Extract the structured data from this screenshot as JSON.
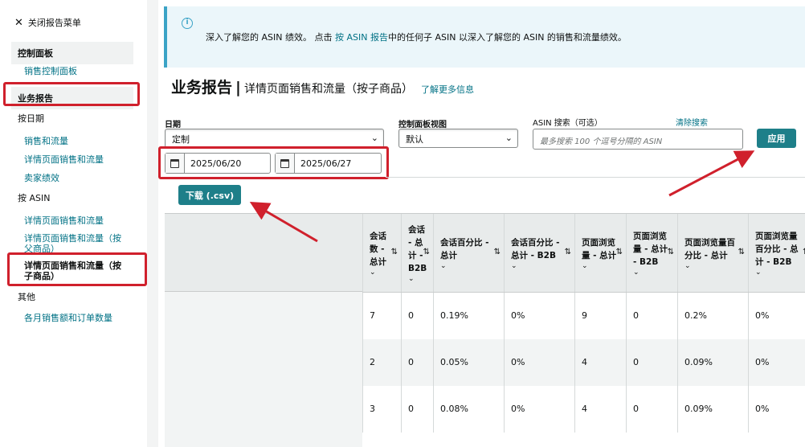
{
  "sidebar": {
    "close_label": "关闭报告菜单",
    "dashboard_header": "控制面板",
    "sales_dashboard": "销售控制面板",
    "business_reports_header": "业务报告",
    "by_date": "按日期",
    "by_date_items": [
      "销售和流量",
      "详情页面销售和流量",
      "卖家绩效"
    ],
    "by_asin": "按 ASIN",
    "asin_item_1": "详情页面销售和流量",
    "asin_item_2_line1": "详情页面销售和流量（按",
    "asin_item_2_line2": "父商品）",
    "asin_item_3_line1": "详情页面销售和流量（按",
    "asin_item_3_line2": "子商品）",
    "other": "其他",
    "monthly": "各月销售额和订单数量"
  },
  "banner": {
    "icon": "i",
    "text_before": "深入了解您的 ASIN 绩效。 点击",
    "link": "按 ASIN 报告",
    "text_after": "中的任何子 ASIN 以深入了解您的 ASIN 的销售和流量绩效。"
  },
  "title": {
    "main": "业务报告",
    "sep": "|",
    "sub": "详情页面销售和流量（按子商品）",
    "learn_more": "了解更多信息"
  },
  "filters": {
    "date_label": "日期",
    "date_value": "定制",
    "start_date": "2025/06/20",
    "end_date": "2025/06/27",
    "view_label": "控制面板视图",
    "view_value": "默认",
    "asin_label": "ASIN 搜索（可选）",
    "clear_search": "清除搜索",
    "asin_placeholder": "最多搜索 100 个逗号分隔的 ASIN",
    "apply": "应用",
    "download": "下载 (.csv)"
  },
  "table": {
    "headers": [
      "会话数 - 总计",
      "会话 - 总计 - B2B",
      "会话百分比 - 总计",
      "会话百分比 - 总计 - B2B",
      "页面浏览量 - 总计",
      "页面浏览量 - 总计 - B2B",
      "页面浏览量百分比 - 总计",
      "页面浏览量百分比 - 总计 - B2B"
    ],
    "header_display": [
      "会<br>话<br>数 -<br>总<br>计",
      "会<br>话 -<br>总<br>计 -<br>B2B",
      "会话百分比<br>- 总计",
      "会话百分比<br>- 总计 -<br>B2B",
      "页面浏<br>览量 -<br>总计",
      "页面浏<br>览量 -<br>总计 -<br>B2B",
      "页面浏览量<br>百分比 - 总<br>计",
      "页面浏览量<br>百分比 - 总<br>计 - B2B"
    ],
    "rows": [
      [
        "7",
        "0",
        "0.19%",
        "0%",
        "9",
        "0",
        "0.2%",
        "0%"
      ],
      [
        "2",
        "0",
        "0.05%",
        "0%",
        "4",
        "0",
        "0.09%",
        "0%"
      ],
      [
        "3",
        "0",
        "0.08%",
        "0%",
        "4",
        "0",
        "0.09%",
        "0%"
      ]
    ]
  },
  "colors": {
    "accent": "#007185",
    "button": "#1e7f89",
    "highlight": "#d0202c",
    "banner_bg": "#ebf6fa"
  }
}
